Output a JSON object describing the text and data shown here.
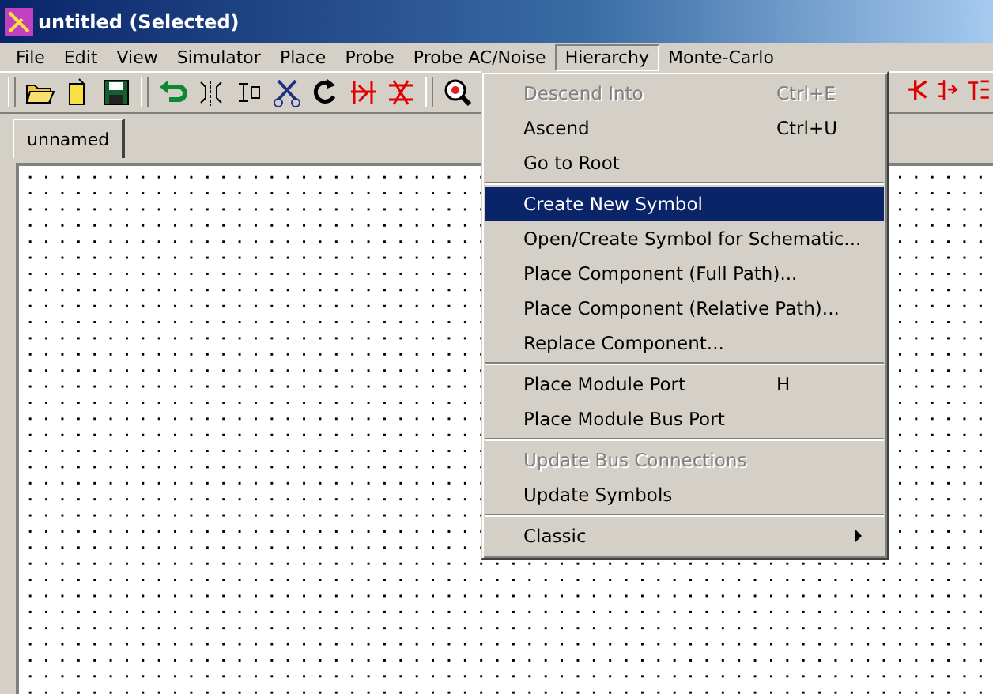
{
  "window": {
    "title": "untitled (Selected)"
  },
  "menu_bar": [
    {
      "label": "File",
      "selected": false
    },
    {
      "label": "Edit",
      "selected": false
    },
    {
      "label": "View",
      "selected": false
    },
    {
      "label": "Simulator",
      "selected": false
    },
    {
      "label": "Place",
      "selected": false
    },
    {
      "label": "Probe",
      "selected": false
    },
    {
      "label": "Probe AC/Noise",
      "selected": false
    },
    {
      "label": "Hierarchy",
      "selected": true
    },
    {
      "label": "Monte-Carlo",
      "selected": false
    }
  ],
  "tabs": [
    {
      "label": "unnamed",
      "selected": true
    }
  ],
  "hierarchy_menu": [
    {
      "kind": "item",
      "label": "Descend Into",
      "shortcut": "Ctrl+E",
      "disabled": true,
      "selected": false
    },
    {
      "kind": "item",
      "label": "Ascend",
      "shortcut": "Ctrl+U",
      "disabled": false,
      "selected": false
    },
    {
      "kind": "item",
      "label": "Go to Root",
      "disabled": false,
      "selected": false
    },
    {
      "kind": "separator"
    },
    {
      "kind": "item",
      "label": "Create New Symbol",
      "disabled": false,
      "selected": true
    },
    {
      "kind": "item",
      "label": "Open/Create Symbol for Schematic...",
      "disabled": false,
      "selected": false
    },
    {
      "kind": "item",
      "label": "Place Component (Full Path)...",
      "disabled": false,
      "selected": false
    },
    {
      "kind": "item",
      "label": "Place Component (Relative Path)...",
      "disabled": false,
      "selected": false
    },
    {
      "kind": "item",
      "label": "Replace Component...",
      "disabled": false,
      "selected": false
    },
    {
      "kind": "separator"
    },
    {
      "kind": "item",
      "label": "Place Module Port",
      "shortcut": "H",
      "disabled": false,
      "selected": false
    },
    {
      "kind": "item",
      "label": "Place Module Bus Port",
      "disabled": false,
      "selected": false
    },
    {
      "kind": "separator"
    },
    {
      "kind": "item",
      "label": "Update Bus Connections",
      "disabled": true,
      "selected": false
    },
    {
      "kind": "item",
      "label": "Update Symbols",
      "disabled": false,
      "selected": false
    },
    {
      "kind": "separator"
    },
    {
      "kind": "submenu",
      "label": "Classic",
      "disabled": false,
      "selected": false
    }
  ]
}
